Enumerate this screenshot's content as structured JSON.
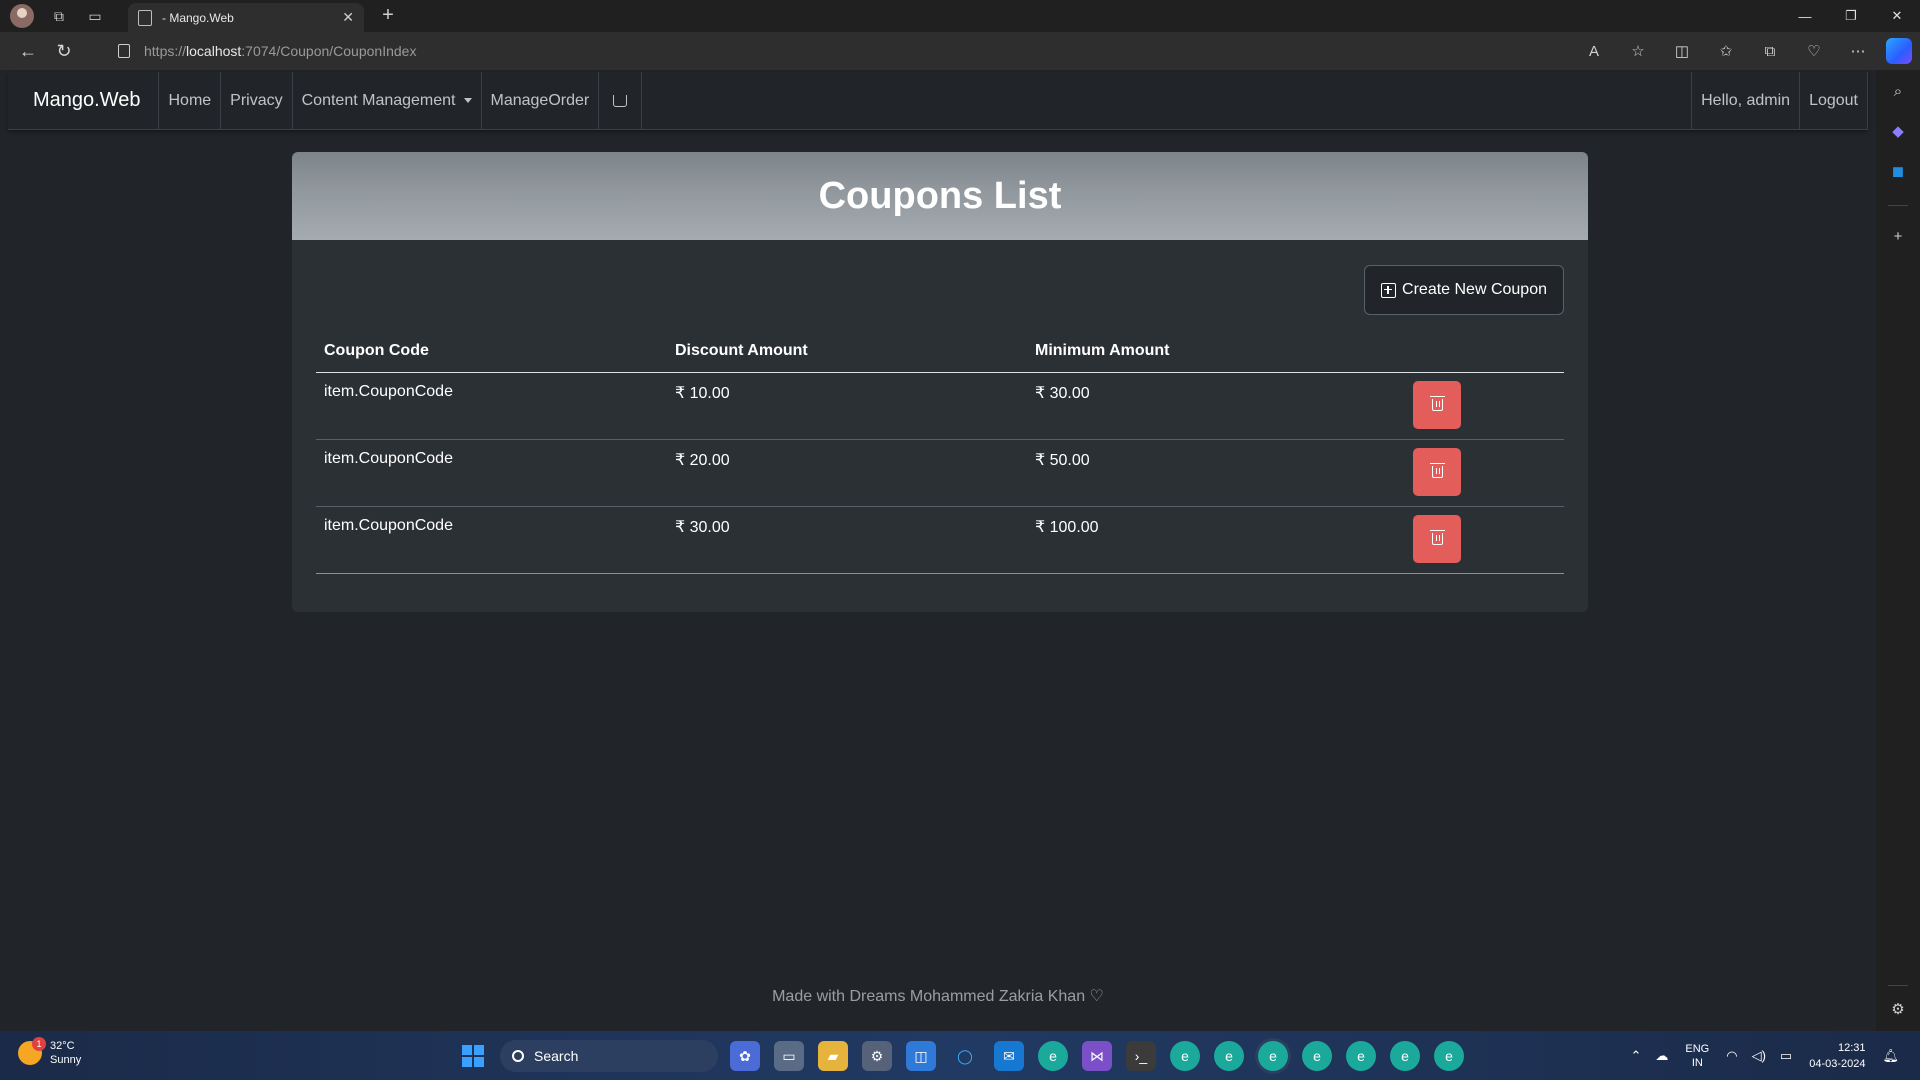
{
  "browser": {
    "tab_title": "- Mango.Web",
    "url_prefix": "https://",
    "url_host": "localhost",
    "url_path": ":7074/Coupon/CouponIndex"
  },
  "navbar": {
    "brand": "Mango.Web",
    "links": {
      "home": "Home",
      "privacy": "Privacy",
      "content_management": "Content Management",
      "manage_order": "ManageOrder"
    },
    "greeting": "Hello, admin",
    "logout": "Logout"
  },
  "card": {
    "title": "Coupons List",
    "create_button": "Create New Coupon",
    "headers": [
      "Coupon Code",
      "Discount Amount",
      "Minimum Amount"
    ],
    "rows": [
      {
        "code": "item.CouponCode",
        "discount": "₹ 10.00",
        "minimum": "₹ 30.00"
      },
      {
        "code": "item.CouponCode",
        "discount": "₹ 20.00",
        "minimum": "₹ 50.00"
      },
      {
        "code": "item.CouponCode",
        "discount": "₹ 30.00",
        "minimum": "₹ 100.00"
      }
    ]
  },
  "footer": "Made with Dreams Mohammed Zakria Khan ♡",
  "taskbar": {
    "weather_temp": "32°C",
    "weather_desc": "Sunny",
    "weather_badge": "1",
    "search_label": "Search",
    "lang_top": "ENG",
    "lang_bottom": "IN",
    "time": "12:31",
    "date": "04-03-2024"
  },
  "colors": {
    "page_bg": "#212529",
    "card_bg": "#2b3035",
    "delete_button": "#e35d5b"
  }
}
